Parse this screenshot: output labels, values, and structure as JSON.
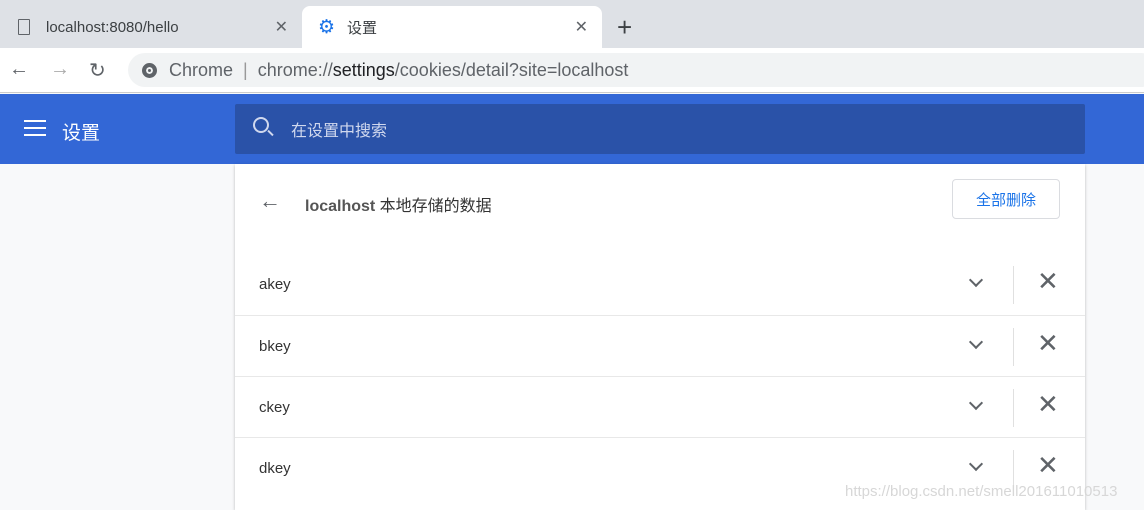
{
  "tabs": [
    {
      "label": "localhost:8080/hello",
      "icon": "document-icon"
    },
    {
      "label": "设置",
      "icon": "gear-icon",
      "active": true
    }
  ],
  "omnibox": {
    "chip": "Chrome",
    "url_prefix": "chrome://",
    "url_host": "settings",
    "url_rest": "/cookies/detail?site=localhost"
  },
  "header": {
    "title": "设置",
    "search_placeholder": "在设置中搜索"
  },
  "card": {
    "site": "localhost",
    "title_rest": " 本地存储的数据",
    "delete_all": "全部删除"
  },
  "items": [
    {
      "key": "akey"
    },
    {
      "key": "bkey"
    },
    {
      "key": "ckey"
    },
    {
      "key": "dkey"
    }
  ],
  "watermark": "https://blog.csdn.net/smell201611010513",
  "colors": {
    "header": "#3367d6",
    "search": "#2a52a8",
    "accent": "#1a73e8"
  }
}
